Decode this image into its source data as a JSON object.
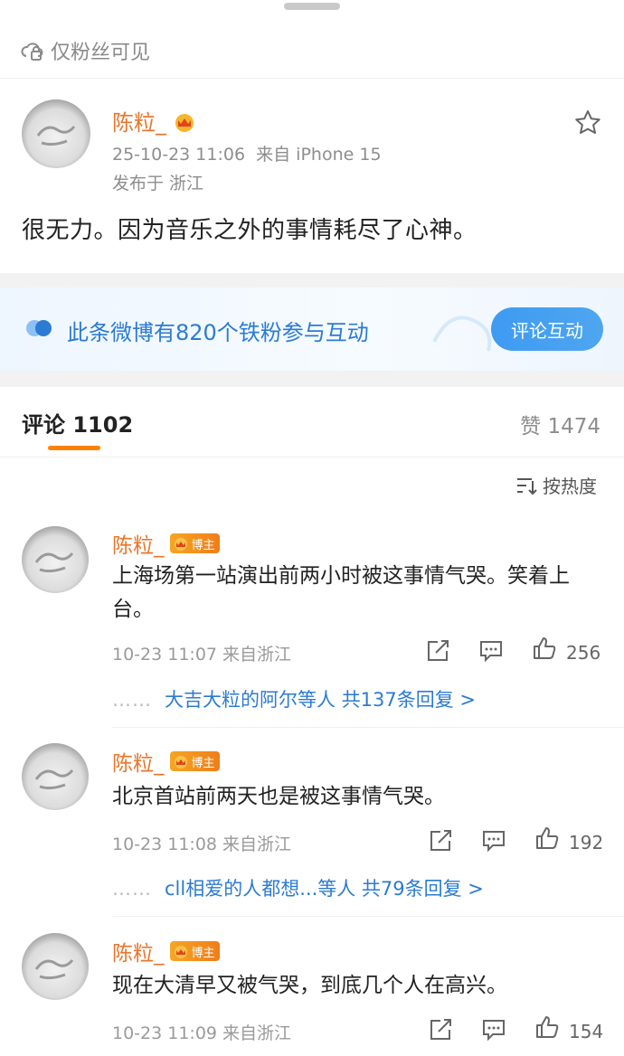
{
  "visibility": {
    "label": "仅粉丝可见",
    "icon": "lock-cloud-icon"
  },
  "post": {
    "author": "陈粒_",
    "timestamp": "25-10-23 11:06",
    "source": "来自 iPhone 15",
    "location": "发布于 浙江",
    "body": "很无力。因为音乐之外的事情耗尽了心神。"
  },
  "fans_banner": {
    "text": "此条微博有820个铁粉参与互动",
    "button": "评论互动",
    "accent": "#2b7bd3"
  },
  "tabs": {
    "comments_label": "评论 1102",
    "likes_label": "赞 1474"
  },
  "sort": {
    "label": "按热度"
  },
  "comments": [
    {
      "author": "陈粒_",
      "badge": "博主",
      "text": "上海场第一站演出前两小时被这事情气哭。笑着上台。",
      "meta": "10-23 11:07 来自浙江",
      "likes": "256",
      "reply_ellipsis": "……",
      "reply_text": "大吉大粒的阿尔等人  共137条回复 >"
    },
    {
      "author": "陈粒_",
      "badge": "博主",
      "text": "北京首站前两天也是被这事情气哭。",
      "meta": "10-23 11:08 来自浙江",
      "likes": "192",
      "reply_ellipsis": "……",
      "reply_text": "cll相爱的人都想...等人  共79条回复 >"
    },
    {
      "author": "陈粒_",
      "badge": "博主",
      "text": "现在大清早又被气哭，到底几个人在高兴。",
      "meta": "10-23 11:09 来自浙江",
      "likes": "154"
    }
  ],
  "colors": {
    "name": "#e8762c",
    "link": "#2b7bd3",
    "tab_accent": "#ff8200"
  }
}
